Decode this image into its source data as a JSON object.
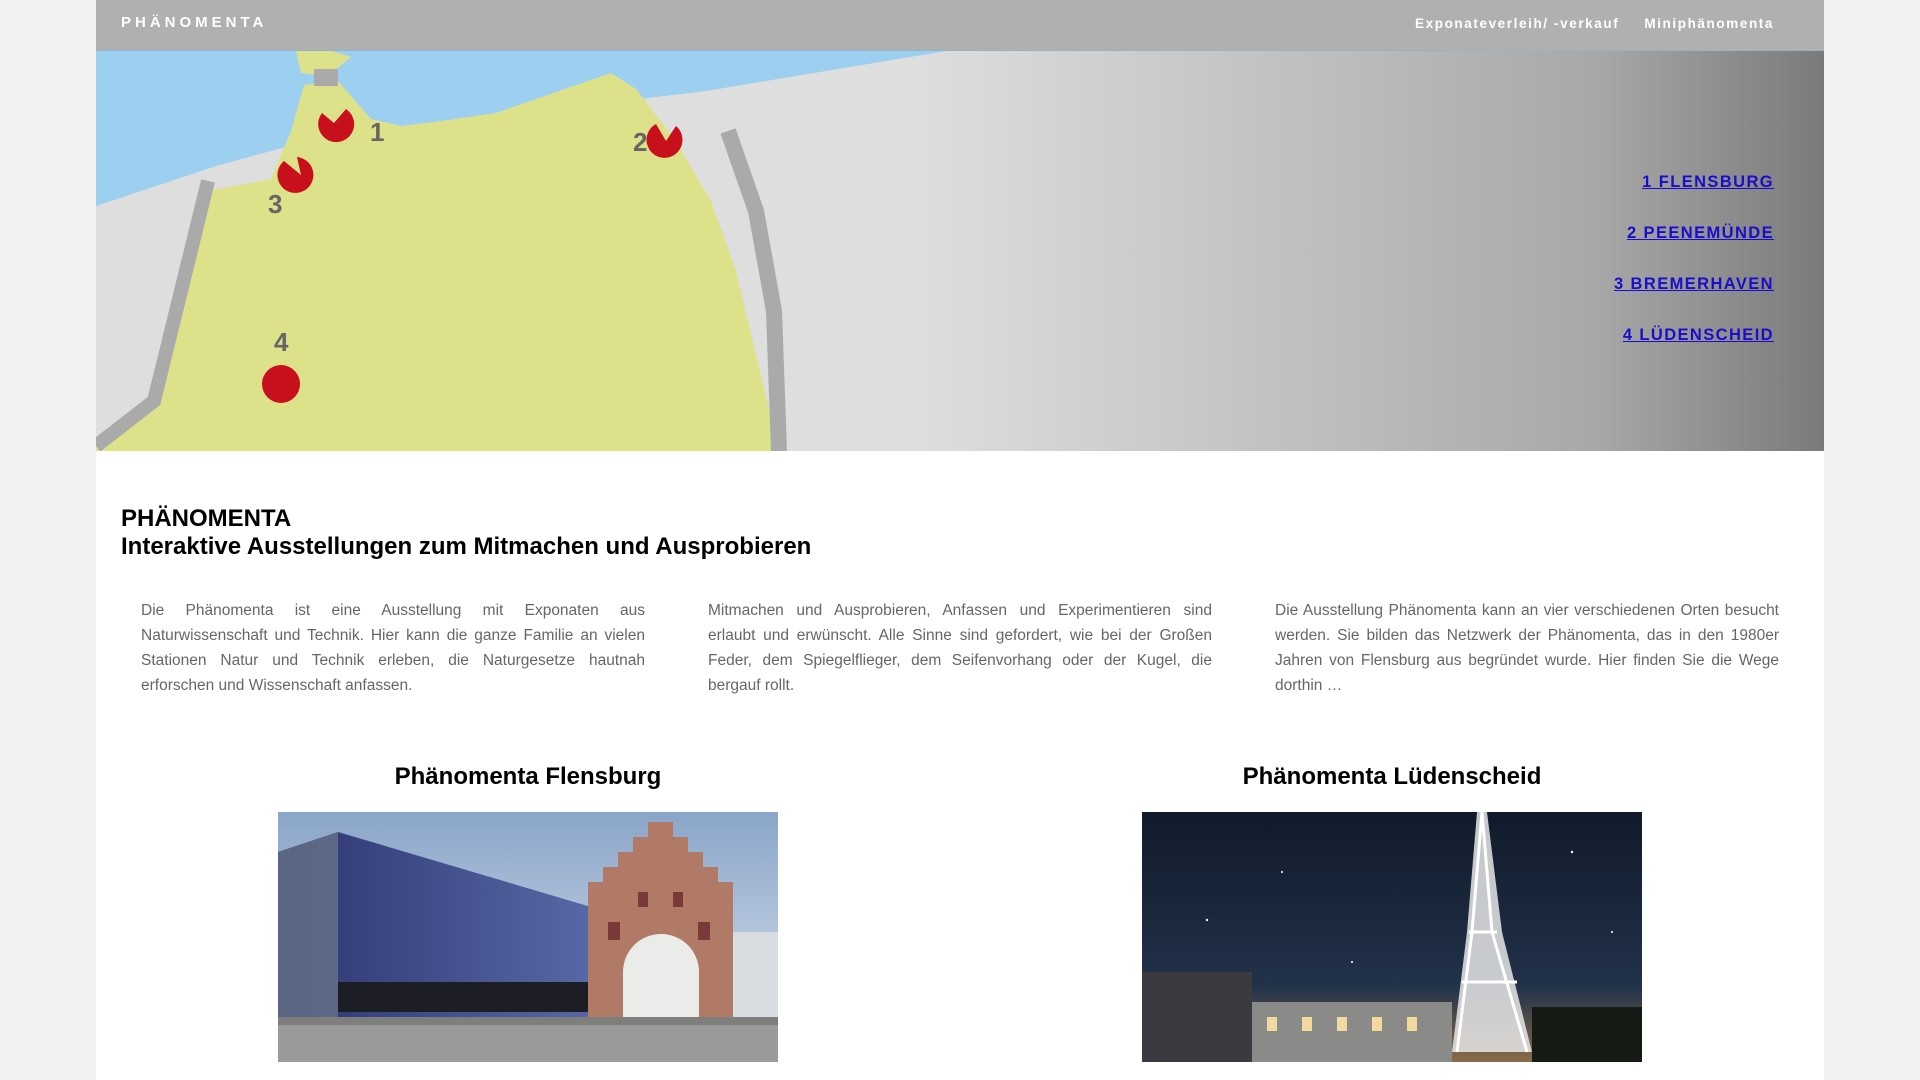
{
  "header": {
    "brand": "PHÄNOMENTA",
    "nav": [
      {
        "label": "Exponateverleih/ -verkauf"
      },
      {
        "label": "Miniphänomenta"
      }
    ]
  },
  "map": {
    "markers": [
      "1",
      "2",
      "3",
      "4"
    ],
    "colors": {
      "water": "#9dcff0",
      "land": "#dde28a",
      "border": "#aaaaaa",
      "marker": "#c8101c"
    }
  },
  "locations": [
    {
      "label": "1 FLENSBURG"
    },
    {
      "label": "2 PEENEMÜNDE"
    },
    {
      "label": "3 BREMERHAVEN"
    },
    {
      "label": "4 LÜDENSCHEID"
    }
  ],
  "intro": {
    "title": "PHÄNOMENTA",
    "subtitle": "Interaktive Ausstellungen zum Mitmachen und Ausprobieren"
  },
  "columns": [
    {
      "text": "Die Phänomenta ist eine Ausstellung mit Exponaten aus Naturwissenschaft und Technik. Hier kann die ganze Familie an vielen Stationen Natur und Technik erleben, die Naturgesetze hautnah erforschen und Wissenschaft anfassen."
    },
    {
      "text": "Mitmachen und Ausprobieren, Anfassen und Experimentieren sind erlaubt und erwünscht. Alle Sinne sind gefordert, wie bei der Großen Feder, dem Spiegelflieger, dem Seifenvorhang oder der Kugel, die bergauf rollt."
    },
    {
      "text": "Die Ausstellung Phänomenta kann an vier verschiedenen Orten besucht werden. Sie bilden das Netzwerk der Phänomenta, das in den 1980er Jahren von Flensburg aus begründet wurde. Hier finden Sie die Wege dorthin …"
    }
  ],
  "cards": [
    {
      "title": "Phänomenta Flensburg"
    },
    {
      "title": "Phänomenta Lüdenscheid"
    }
  ],
  "accent_color": "#1a0dcc"
}
